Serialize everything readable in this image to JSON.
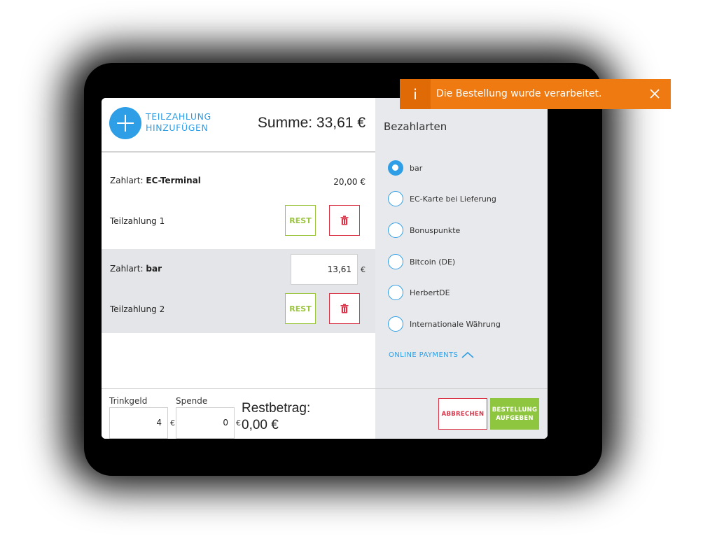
{
  "header": {
    "add_label": "TEILZAHLUNG HINZUFÜGEN",
    "sum": "Summe: 33,61 €"
  },
  "payments": [
    {
      "zahlart_prefix": "Zahlart:",
      "zahlart_value": "EC-Terminal",
      "amount": "20,00 €",
      "name": "Teilzahlung 1",
      "rest_label": "REST"
    },
    {
      "zahlart_prefix": "Zahlart:",
      "zahlart_value": "bar",
      "amount": "13,61",
      "currency": "€",
      "name": "Teilzahlung 2",
      "rest_label": "REST"
    }
  ],
  "footer": {
    "tip_label": "Trinkgeld",
    "tip_value": "4",
    "donation_label": "Spende",
    "donation_value": "0",
    "currency": "€",
    "remaining_label": "Restbetrag:",
    "remaining_value": "0,00 €"
  },
  "payment_methods": {
    "title": "Bezahlarten",
    "options": [
      {
        "label": "bar",
        "selected": true
      },
      {
        "label": "EC-Karte bei Lieferung",
        "selected": false
      },
      {
        "label": "Bonuspunkte",
        "selected": false
      },
      {
        "label": "Bitcoin (DE)",
        "selected": false
      },
      {
        "label": "HerbertDE",
        "selected": false
      },
      {
        "label": "Internationale Währung",
        "selected": false
      }
    ],
    "online_payments": "ONLINE PAYMENTS"
  },
  "actions": {
    "cancel": "ABBRECHEN",
    "submit_line1": "BESTELLUNG",
    "submit_line2": "AUFGEBEN"
  },
  "toast": {
    "icon": "i",
    "message": "Die Bestellung wurde verarbeitet."
  },
  "colors": {
    "accent": "#2e9ee6",
    "rest_green": "#9bc53d",
    "danger": "#d9364a",
    "submit_green": "#8fc63f",
    "toast_orange": "#f07a12"
  }
}
